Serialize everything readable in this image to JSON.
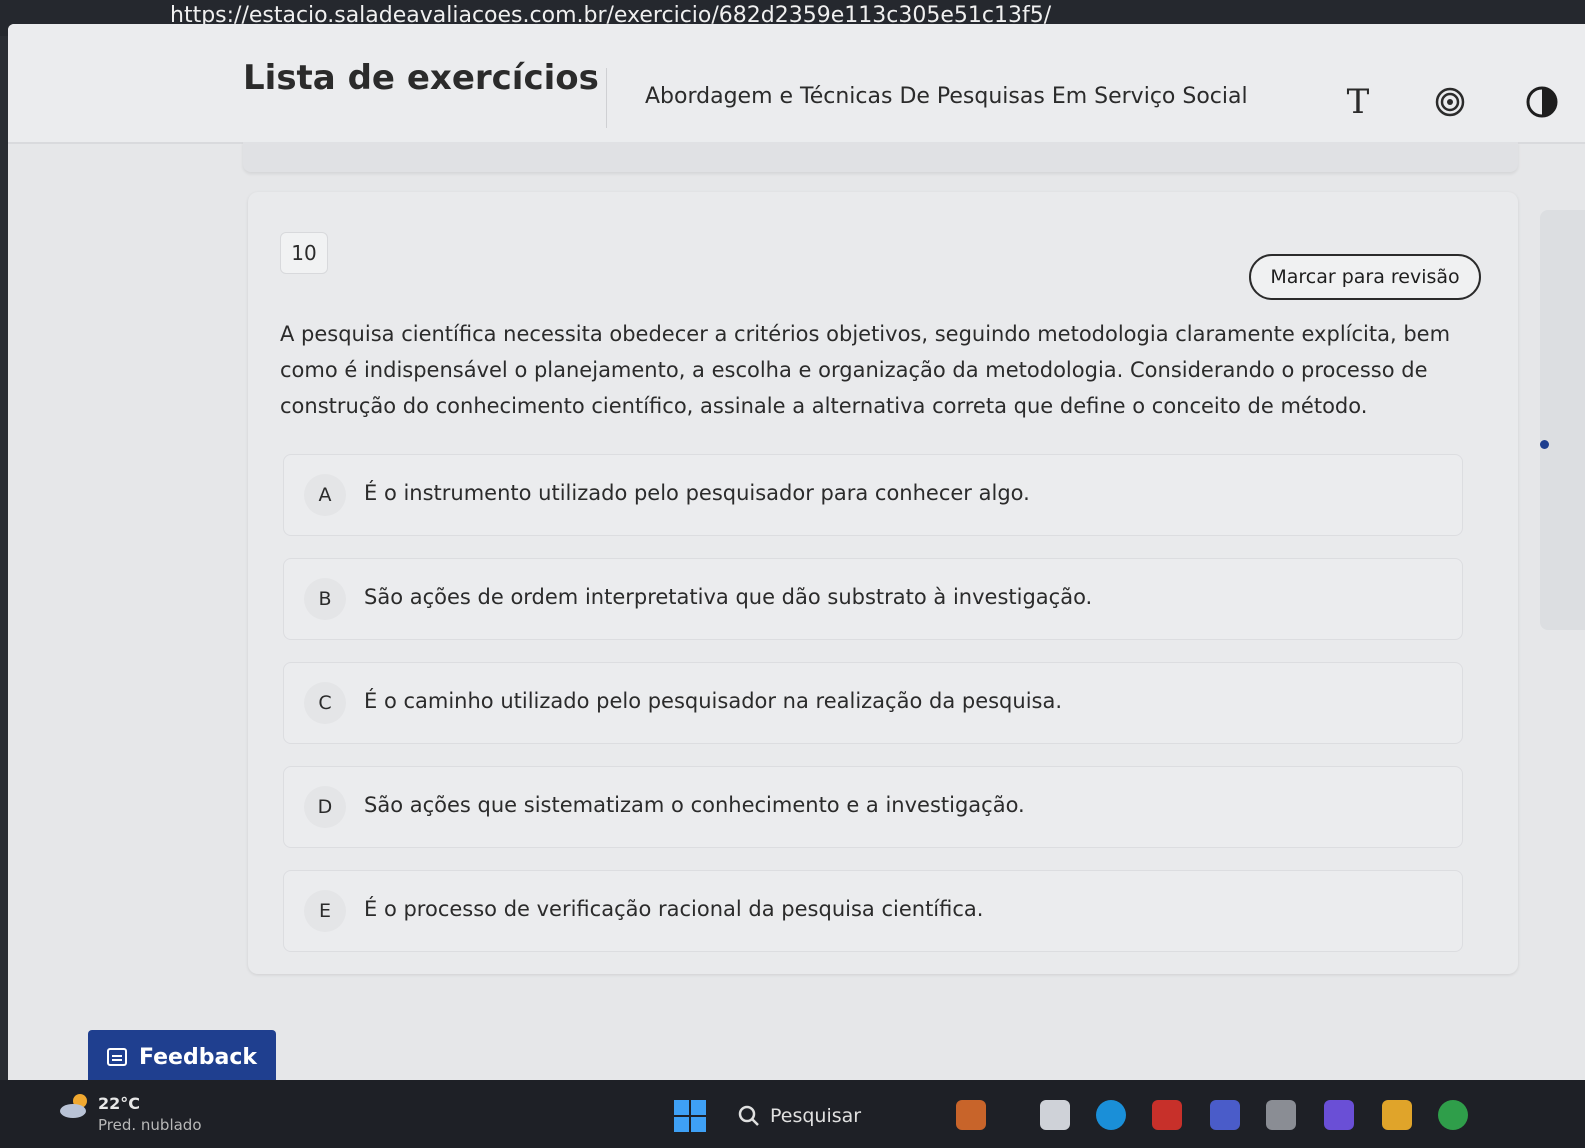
{
  "browser": {
    "url": "https://estacio.saladeavaliacoes.com.br/exercicio/682d2359e113c305e51c13f5/"
  },
  "header": {
    "title": "Lista de exercícios",
    "subject": "Abordagem e Técnicas De Pesquisas Em Serviço Social",
    "font_tool": "T",
    "tools": [
      "font-size-icon",
      "target-icon",
      "contrast-icon"
    ]
  },
  "question": {
    "number": "10",
    "review_label": "Marcar para revisão",
    "text": "A pesquisa científica necessita obedecer a critérios objetivos, seguindo metodologia claramente explícita, bem como é indispensável o planejamento, a escolha e organização da metodologia. Considerando o processo de construção do conhecimento científico, assinale a alternativa correta que define o conceito de método.",
    "options": [
      {
        "letter": "A",
        "text": "É o instrumento utilizado pelo pesquisador para conhecer algo."
      },
      {
        "letter": "B",
        "text": "São ações de ordem interpretativa que dão substrato à investigação."
      },
      {
        "letter": "C",
        "text": "É o caminho utilizado pelo pesquisador na realização da pesquisa."
      },
      {
        "letter": "D",
        "text": "São ações que sistematizam o conhecimento e a investigação."
      },
      {
        "letter": "E",
        "text": "É o processo de verificação racional da pesquisa científica."
      }
    ]
  },
  "feedback": {
    "label": "Feedback"
  },
  "taskbar": {
    "temperature": "22°C",
    "weather": "Pred. nublado",
    "search_label": "Pesquisar"
  },
  "colors": {
    "accent": "#1f3f8f",
    "page_bg": "#e6e7e9",
    "card_bg": "#e9eaec",
    "text": "#2b2b2b",
    "taskbar": "#1e2026"
  }
}
